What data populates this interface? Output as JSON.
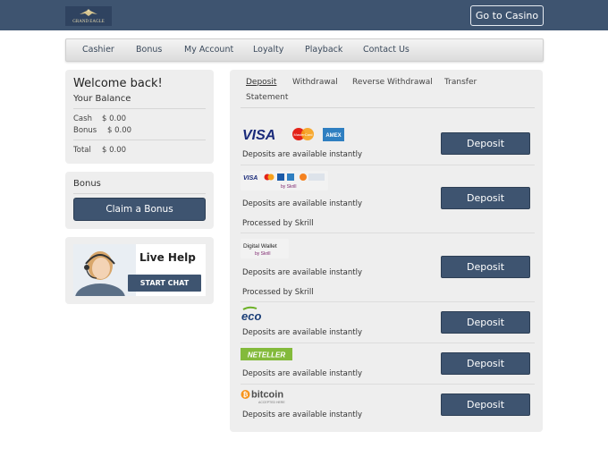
{
  "header": {
    "logo_text": "GRAND EAGLE",
    "go_casino": "Go to Casino",
    "colors": {
      "bar": "#3e5470",
      "button": "#3e5470"
    }
  },
  "nav": [
    "Cashier",
    "Bonus",
    "My Account",
    "Loyalty",
    "Playback",
    "Contact Us"
  ],
  "welcome": {
    "title": "Welcome back!",
    "balance_title": "Your Balance",
    "cash_label": "Cash",
    "cash_value": "$ 0.00",
    "bonus_label": "Bonus",
    "bonus_value": "$ 0.00",
    "total_label": "Total",
    "total_value": "$ 0.00"
  },
  "bonus_panel": {
    "title": "Bonus",
    "button": "Claim a Bonus"
  },
  "live_help": {
    "title": "Live Help",
    "button": "START CHAT"
  },
  "tabs": [
    "Deposit",
    "Withdrawal",
    "Reverse Withdrawal",
    "Transfer",
    "Statement"
  ],
  "methods": [
    {
      "logo": "visa-mastercard-amex-logos",
      "logo_texts": [
        "VISA",
        "MasterCard",
        "AMEX"
      ],
      "note": "Deposits are available instantly",
      "button": "Deposit"
    },
    {
      "logo": "skrill-cards-logo",
      "logo_texts": [
        "VISA",
        "by Skrill"
      ],
      "note": "Deposits are available instantly",
      "note2": "Processed by Skrill",
      "button": "Deposit"
    },
    {
      "logo": "skrill-digital-wallet-logo",
      "logo_texts": [
        "Digital Wallet",
        "by Skrill"
      ],
      "note": "Deposits are available instantly",
      "note2": "Processed by Skrill",
      "button": "Deposit"
    },
    {
      "logo": "eco-logo",
      "logo_texts": [
        "eco"
      ],
      "note": "Deposits are available instantly",
      "button": "Deposit"
    },
    {
      "logo": "neteller-logo",
      "logo_texts": [
        "NETELLER"
      ],
      "note": "Deposits are available instantly",
      "button": "Deposit"
    },
    {
      "logo": "bitcoin-logo",
      "logo_texts": [
        "bitcoin",
        "ACCEPTED HERE"
      ],
      "note": "Deposits are available instantly",
      "button": "Deposit"
    }
  ]
}
